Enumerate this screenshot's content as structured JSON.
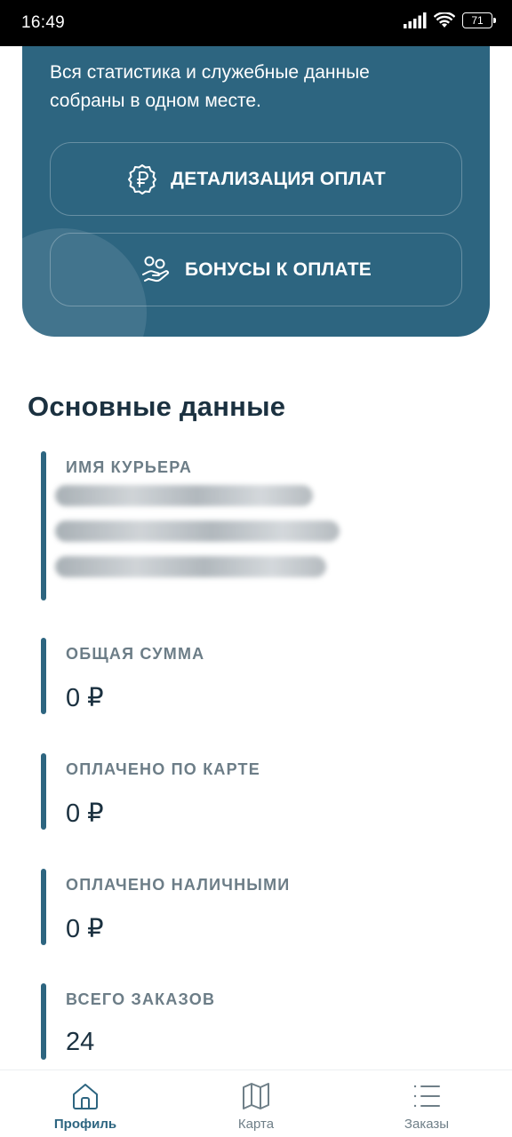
{
  "status_bar": {
    "time": "16:49",
    "battery": "71"
  },
  "hero": {
    "description": "Вся статистика и служебные данные собраны в одном месте.",
    "buttons": [
      {
        "label": "ДЕТАЛИЗАЦИЯ ОПЛАТ",
        "icon": "ruble-badge-icon"
      },
      {
        "label": "БОНУСЫ К ОПЛАТЕ",
        "icon": "hand-coins-icon"
      }
    ]
  },
  "main": {
    "section_title": "Основные данные",
    "fields": [
      {
        "label": "ИМЯ КУРЬЕРА",
        "value": ""
      },
      {
        "label": "ОБЩАЯ СУММА",
        "value": "0 ₽"
      },
      {
        "label": "ОПЛАЧЕНО ПО КАРТЕ",
        "value": "0 ₽"
      },
      {
        "label": "ОПЛАЧЕНО НАЛИЧНЫМИ",
        "value": "0 ₽"
      },
      {
        "label": "ВСЕГО ЗАКАЗОВ",
        "value": "24"
      }
    ]
  },
  "bottom_nav": {
    "items": [
      {
        "label": "Профиль",
        "icon": "home-icon",
        "active": true
      },
      {
        "label": "Карта",
        "icon": "map-icon",
        "active": false
      },
      {
        "label": "Заказы",
        "icon": "list-icon",
        "active": false
      }
    ]
  },
  "colors": {
    "accent": "#2d6580",
    "text_dark": "#1b3140",
    "label_gray": "#6c7d87"
  }
}
